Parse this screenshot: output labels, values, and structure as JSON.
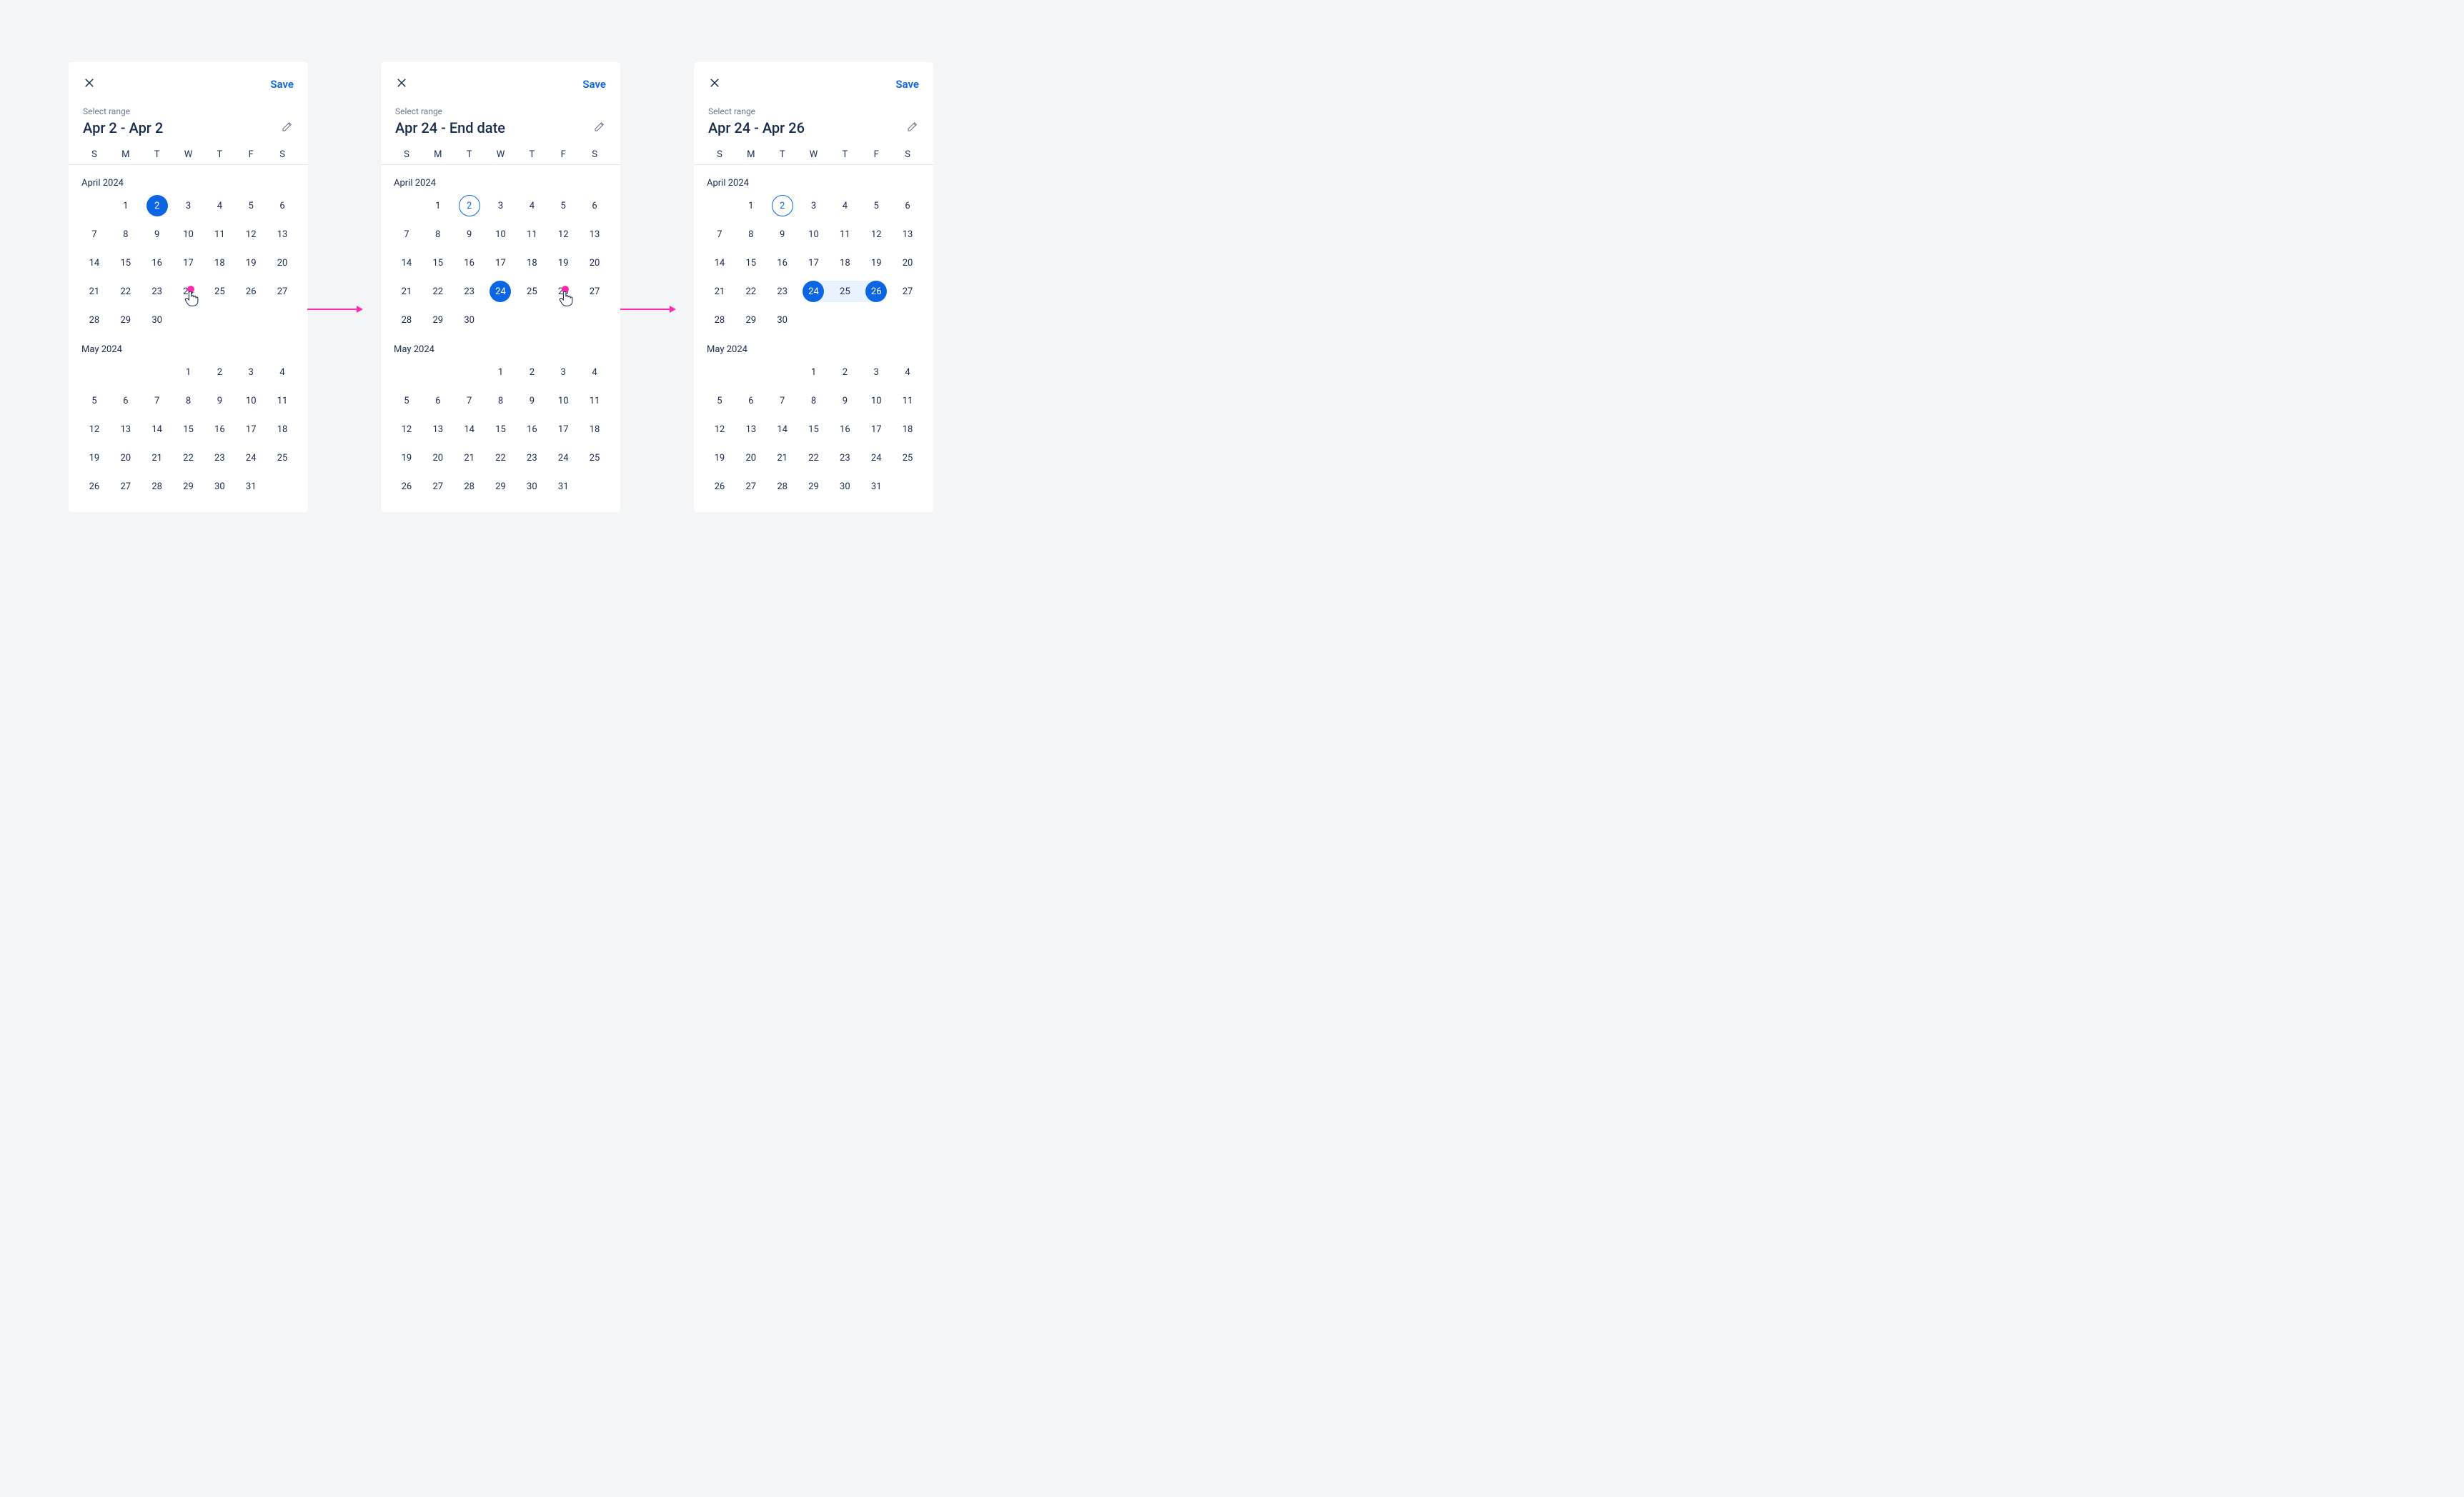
{
  "common": {
    "save_label": "Save",
    "select_range_label": "Select range",
    "weekdays": [
      "S",
      "M",
      "T",
      "W",
      "T",
      "F",
      "S"
    ],
    "month_a_label": "April 2024",
    "month_b_label": "May 2024",
    "april_start_weekday": 1,
    "april_days": 30,
    "may_start_weekday": 3,
    "may_days": 31,
    "colors": {
      "brand": "#0c66e4",
      "arrow": "#ff2bb0",
      "range_bg": "#e9f2ff"
    }
  },
  "panels": [
    {
      "range_text": "Apr 2 - Apr 2",
      "april": {
        "outline": [],
        "solid": [
          2
        ],
        "range_middle": [],
        "range_start": null,
        "range_end": null
      },
      "cursor_on_april_day": 24
    },
    {
      "range_text": "Apr 24 - End date",
      "april": {
        "outline": [
          2
        ],
        "solid": [
          24
        ],
        "range_middle": [],
        "range_start": null,
        "range_end": null
      },
      "cursor_on_april_day": 26
    },
    {
      "range_text": "Apr 24 - Apr 26",
      "april": {
        "outline": [
          2
        ],
        "solid": [
          24,
          26
        ],
        "range_middle": [
          25
        ],
        "range_start": 24,
        "range_end": 26
      },
      "cursor_on_april_day": null
    }
  ]
}
